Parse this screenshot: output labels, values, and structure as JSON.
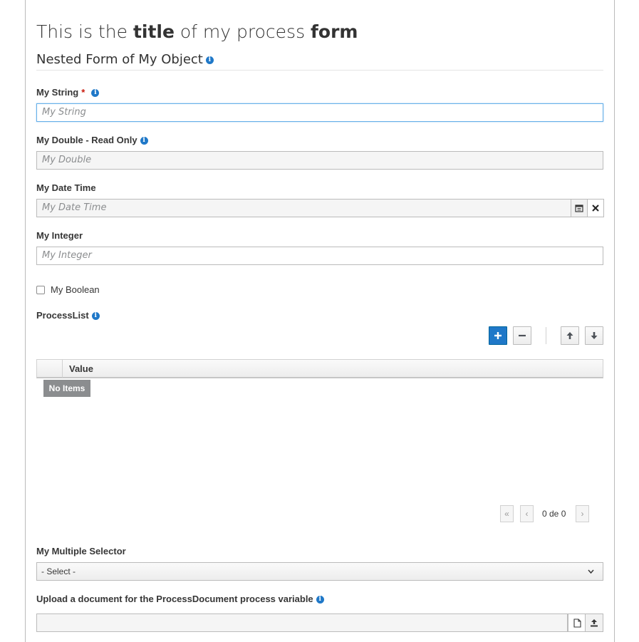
{
  "form": {
    "title_prefix": "This is the ",
    "title_bold1": "title",
    "title_middle": " of my process ",
    "title_bold2": "form",
    "section_title": "Nested Form of My Object"
  },
  "fields": {
    "my_string": {
      "label": "My String",
      "required_mark": "*",
      "placeholder": "My String"
    },
    "my_double": {
      "label": "My Double - Read Only",
      "placeholder": "My Double"
    },
    "my_date_time": {
      "label": "My Date Time",
      "placeholder": "My Date Time"
    },
    "my_integer": {
      "label": "My Integer",
      "placeholder": "My Integer"
    },
    "my_boolean": {
      "label": "My Boolean",
      "checked": false
    }
  },
  "process_list": {
    "label": "ProcessList",
    "column_header": "Value",
    "empty_text": "No Items",
    "pagination": "0 de 0"
  },
  "multiple_selector": {
    "label": "My Multiple Selector",
    "value": "- Select -"
  },
  "upload": {
    "label": "Upload a document for the ProcessDocument process variable"
  },
  "icons": {
    "info": "info-icon",
    "calendar": "calendar-icon",
    "clear": "close-icon",
    "add": "plus-icon",
    "remove": "minus-icon",
    "move_up": "arrow-up-icon",
    "move_down": "arrow-down-icon",
    "first_page": "double-chevron-left-icon",
    "prev_page": "chevron-left-icon",
    "next_page": "chevron-right-icon",
    "dropdown": "chevron-down-icon",
    "file": "file-icon",
    "upload": "upload-icon"
  },
  "colors": {
    "primary": "#1f78c8",
    "required": "#c9190b",
    "focus_border": "#66afe9",
    "no_items_bg": "#8b8d8f"
  }
}
